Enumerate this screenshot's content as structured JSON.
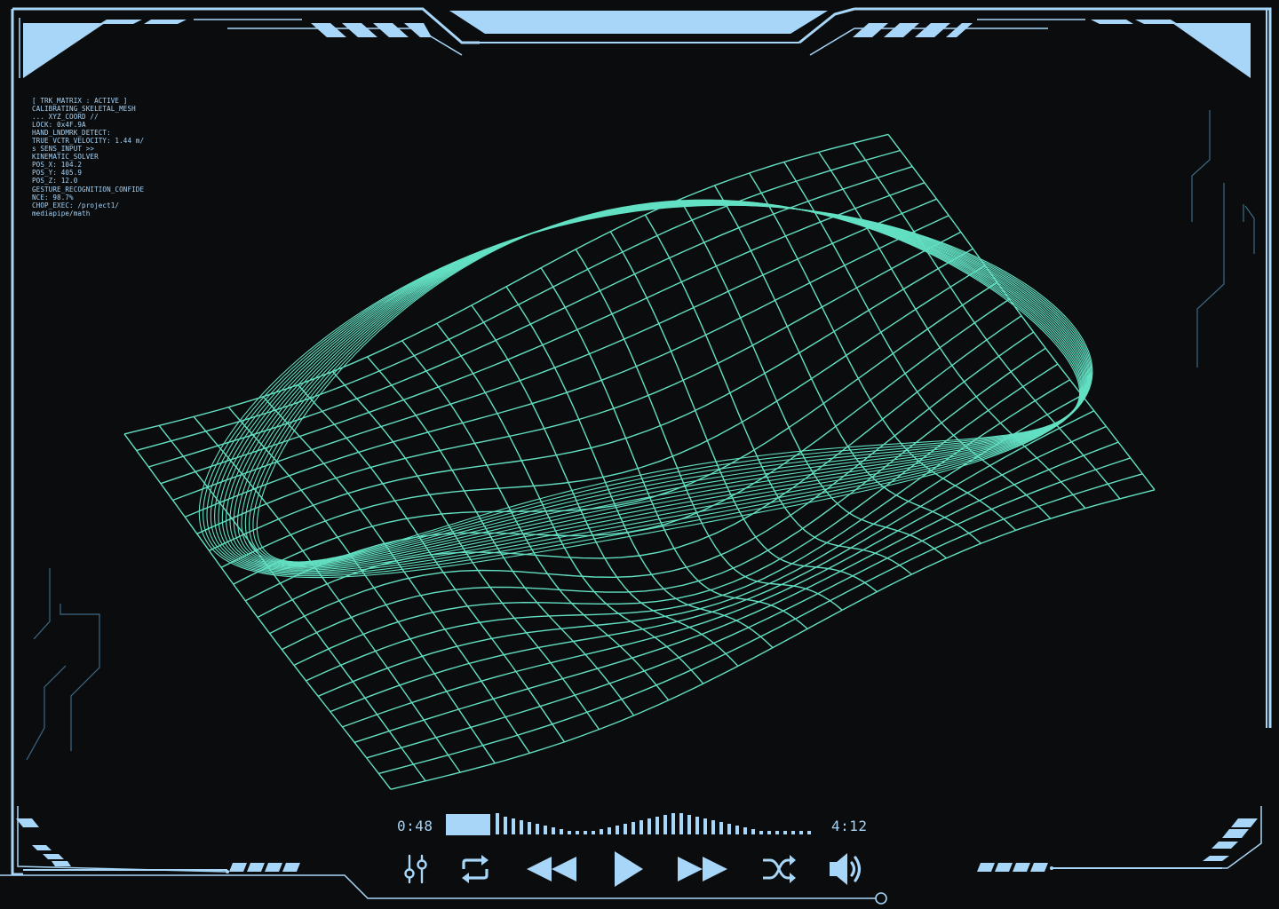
{
  "colors": {
    "frame": "#a8d6f8",
    "frame_dim": "#3e6a86",
    "mesh": "#63e0c3",
    "background": "#0b0c0d",
    "text": "#a6d3f5"
  },
  "readout": {
    "lines": [
      "[ TRK_MATRIX : ACTIVE ]",
      "CALIBRATING_SKELETAL_MESH",
      "... XYZ_COORD //",
      "LOCK: 0x4F.9A",
      "HAND_LNDMRK_DETECT:",
      "TRUE VCTR_VELOCITY: 1.44 m/",
      "s SENS_INPUT >>",
      "KINEMATIC_SOLVER",
      "POS_X: 104.2",
      "POS_Y: 405.9",
      "POS_Z: 12.0",
      "GESTURE_RECOGNITION_CONFIDE",
      "NCE: 98.7%",
      "CHOP_EXEC: /project1/",
      "mediapipe/math"
    ]
  },
  "player": {
    "current_time": "0:48",
    "total_time": "4:12",
    "progress": 0.19,
    "controls": [
      "equalizer-icon",
      "repeat-icon",
      "rewind-icon",
      "play-icon",
      "fast-forward-icon",
      "shuffle-icon",
      "volume-icon"
    ]
  }
}
